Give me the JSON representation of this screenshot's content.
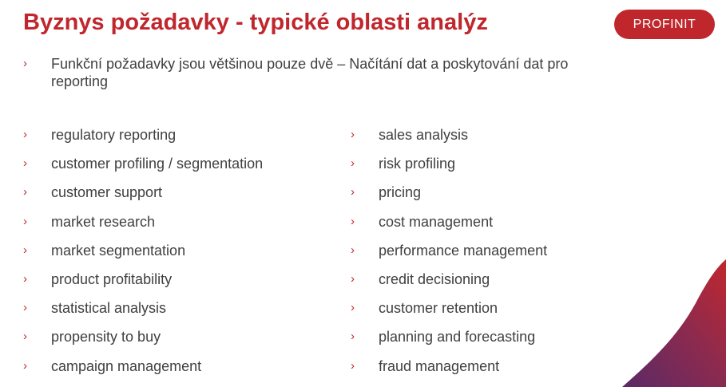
{
  "slide": {
    "title": "Byznys požadavky - typické oblasti analýz",
    "logo_text": "PROFINIT",
    "bullet_glyph": "›",
    "intro": "Funkční požadavky jsou většinou pouze dvě – Načítání dat a poskytování dat pro reporting",
    "left_items": [
      "regulatory reporting",
      "customer profiling / segmentation",
      "customer support",
      "market research",
      "market segmentation",
      "product profitability",
      "statistical analysis",
      "propensity to buy",
      "campaign management"
    ],
    "right_items": [
      "sales analysis",
      "risk profiling",
      "pricing",
      "cost management",
      "performance management",
      "credit decisioning",
      "customer retention",
      "planning and forecasting",
      "fraud management"
    ]
  },
  "colors": {
    "accent": "#c0272d",
    "text": "#3f3f3f",
    "decor_purple": "#6e2a5e"
  }
}
